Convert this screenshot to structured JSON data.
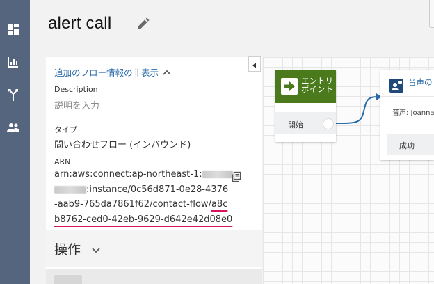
{
  "page": {
    "title": "alert call"
  },
  "info_panel": {
    "toggle_label": "追加のフロー情報の非表示",
    "description_label": "Description",
    "description_placeholder": "説明を入力",
    "type_label": "タイプ",
    "type_value": "問い合わせフロー (インバウンド)",
    "arn_label": "ARN",
    "arn_lines": [
      "arn:aws:connect:ap-northeast-1:",
      ":instance/0c56d871-0e28-4376",
      "-aab9-765da7861f62/contact-flow/",
      "a8c",
      "b8762-ced0-42eb-9629-d642e42d08e0"
    ],
    "actions_label": "操作"
  },
  "flow": {
    "entry_block": {
      "title": "エントリポイント",
      "start_label": "開始"
    },
    "voice_block": {
      "title": "音声の",
      "subtitle": "音声: Joanna",
      "success_label": "成功"
    }
  },
  "icons": {
    "nav": [
      "dashboard-icon",
      "metrics-icon",
      "routing-icon",
      "users-icon"
    ],
    "edit": "pencil-icon",
    "copy": "copy-icon",
    "actions_chevron": "chevron-down-icon",
    "toggle_chevron": "chevron-up-icon",
    "collapse": "chevron-left-icon"
  },
  "colors": {
    "sidebar": "#56657e",
    "link": "#2b6ba8",
    "entry_block": "#4a7a1c",
    "underline": "#d6145f",
    "connector": "#2b6ba8"
  }
}
